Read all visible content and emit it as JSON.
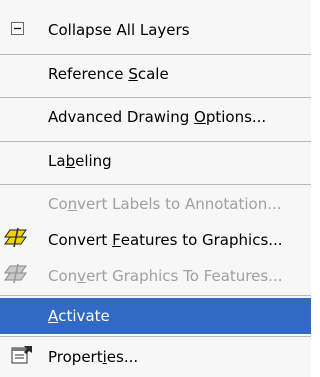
{
  "menu": {
    "items": [
      {
        "pre": "Collapse All Layers",
        "acc": "",
        "post": "",
        "icon": "collapse-box-icon",
        "disabled": false
      },
      {
        "pre": "Reference ",
        "acc": "S",
        "post": "cale",
        "icon": "",
        "disabled": false
      },
      {
        "pre": "Advanced Drawing ",
        "acc": "O",
        "post": "ptions...",
        "icon": "",
        "disabled": false
      },
      {
        "pre": "La",
        "acc": "b",
        "post": "eling",
        "icon": "",
        "disabled": false
      },
      {
        "pre": "Co",
        "acc": "n",
        "post": "vert Labels to Annotation...",
        "icon": "",
        "disabled": true
      },
      {
        "pre": "Convert ",
        "acc": "F",
        "post": "eatures to Graphics...",
        "icon": "features-to-graphics-icon",
        "disabled": false
      },
      {
        "pre": "Con",
        "acc": "v",
        "post": "ert Graphics To Features...",
        "icon": "graphics-to-features-icon",
        "disabled": true
      },
      {
        "pre": "",
        "acc": "A",
        "post": "ctivate",
        "icon": "",
        "disabled": false,
        "selected": true
      },
      {
        "pre": "Propert",
        "acc": "i",
        "post": "es...",
        "icon": "properties-icon",
        "disabled": false
      }
    ]
  },
  "colors": {
    "highlight": "#316ac5",
    "disabled_text": "#a0a0a0",
    "menu_bg": "#f7f7f7",
    "icon_yellow": "#f2d200"
  }
}
